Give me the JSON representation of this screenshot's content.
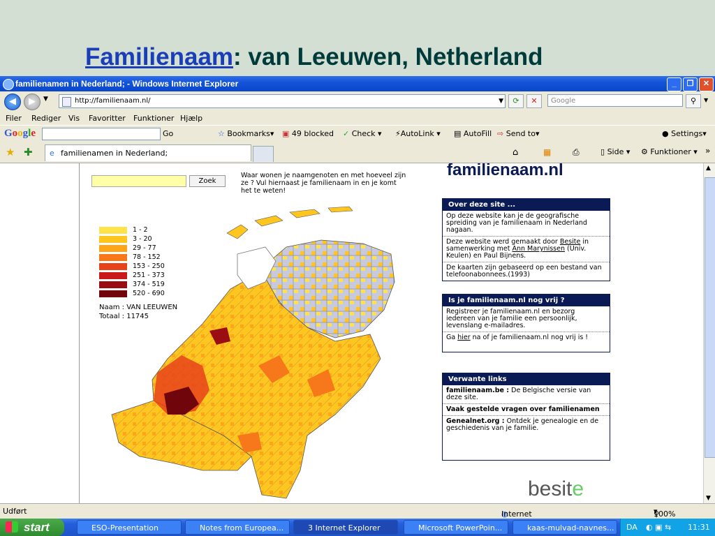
{
  "slide": {
    "title_link": "Familienaam",
    "title_rest": ": van Leeuwen, Netherland"
  },
  "window": {
    "title": "familienamen in Nederland; - Windows Internet Explorer"
  },
  "address": {
    "url": "http://familienaam.nl/",
    "search_placeholder": "Google"
  },
  "menu": [
    "Filer",
    "Rediger",
    "Vis",
    "Favoritter",
    "Funktioner",
    "Hjælp"
  ],
  "google_bar": {
    "logo": "Google",
    "go": "Go",
    "bookmarks": "Bookmarks",
    "blocked": "49 blocked",
    "check": "Check",
    "autolink": "AutoLink",
    "autofill": "AutoFill",
    "sendto": "Send to",
    "settings": "Settings"
  },
  "tabs": {
    "active_tab": "familienamen in Nederland;",
    "side_label": "Side",
    "funk_label": "Funktioner"
  },
  "page": {
    "search_value": "",
    "search_button": "Zoek",
    "intro": "Waar wonen je naamgenoten en met hoeveel zijn ze ? Vul hiernaast je familienaam in en je komt het te weten!",
    "legend": [
      {
        "label": "1 - 2",
        "color": "#ffe34a"
      },
      {
        "label": "3 - 20",
        "color": "#ffc61f"
      },
      {
        "label": "29 - 77",
        "color": "#ffa51a"
      },
      {
        "label": "78 - 152",
        "color": "#f6781a"
      },
      {
        "label": "153 - 250",
        "color": "#e8421a"
      },
      {
        "label": "251 - 373",
        "color": "#c8181a"
      },
      {
        "label": "374 - 519",
        "color": "#9a0d12"
      },
      {
        "label": "520 - 690",
        "color": "#70060c"
      }
    ],
    "naam": "Naam : VAN LEEUWEN",
    "totaal": "Totaal : 11745",
    "site_logo": "familienaam.nl",
    "box1": {
      "header": "Over deze site ...",
      "p1": "Op deze website kan je de geografische spreiding van je familienaam in Nederland nagaan.",
      "p2_a": "Deze website werd gemaakt door ",
      "p2_link1": "Besite",
      "p2_b": " in samenwerking met ",
      "p2_link2": "Ann Marynissen",
      "p2_c": " (Univ. Keulen) en Paul Bijnens.",
      "p3": "De kaarten zijn gebaseerd op een bestand van telefoonabonnees.(1993)"
    },
    "box2": {
      "header": "Is je familienaam.nl nog vrij ?",
      "p1": "Registreer je familienaam.nl en bezorg iedereen van je familie een persoonlijk, levenslang e-mailadres.",
      "p2_a": "Ga ",
      "p2_link": "hier",
      "p2_b": " na of je familienaam.nl nog vrij is !"
    },
    "box3": {
      "header": "Verwante links",
      "l1_bold": "familienaam.be :",
      "l1_rest": " De Belgische versie van deze site.",
      "l2_bold": "Vaak gestelde vragen over familienamen",
      "l3_bold": "Genealnet.org :",
      "l3_rest": " Ontdek je genealogie en de geschiedenis van je familie."
    },
    "besite_main": "besit",
    "besite_e": "e"
  },
  "status": {
    "left": "Udført",
    "zone": "Internet",
    "zoom": "100%"
  },
  "taskbar": {
    "start": "start",
    "items": [
      "ESO-Presentation",
      "Notes from Europea...",
      "3 Internet Explorer",
      "Microsoft PowerPoin...",
      "kaas-mulvad-navnes..."
    ],
    "lang": "DA",
    "clock": "11:31"
  }
}
